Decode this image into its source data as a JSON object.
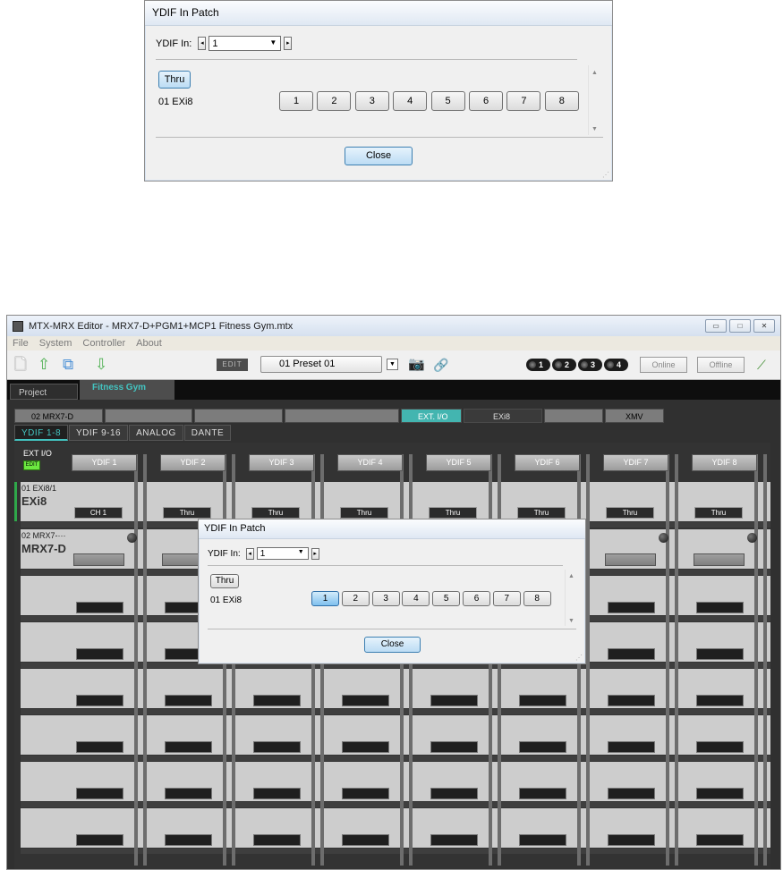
{
  "top_dialog": {
    "title": "YDIF In Patch",
    "ydif_label": "YDIF In:",
    "ydif_value": "1",
    "thru_label": "Thru",
    "device_label": "01 EXi8",
    "channels": [
      "1",
      "2",
      "3",
      "4",
      "5",
      "6",
      "7",
      "8"
    ],
    "close_label": "Close"
  },
  "editor": {
    "title": "MTX-MRX Editor - MRX7-D+PGM1+MCP1 Fitness Gym.mtx",
    "menu": [
      "File",
      "System",
      "Controller",
      "About"
    ],
    "toolbar": {
      "edit_label": "EDIT",
      "preset_value": "01 Preset 01",
      "scenes": [
        "1",
        "2",
        "3",
        "4"
      ],
      "online_label": "Online",
      "offline_label": "Offline"
    },
    "project_tabs": [
      "Project",
      "Fitness Gym"
    ],
    "device_tabs": [
      "02 MRX7-D",
      "",
      "",
      "",
      "EXT. I/O",
      "EXi8",
      "",
      "XMV"
    ],
    "sub_tabs": [
      "YDIF 1-8",
      "YDIF 9-16",
      "ANALOG",
      "DANTE"
    ],
    "grid": {
      "ext_io_label": "EXT I/O",
      "edit_small": "EDIT",
      "ydif_headers": [
        "YDIF 1",
        "YDIF 2",
        "YDIF 3",
        "YDIF 4",
        "YDIF 5",
        "YDIF 6",
        "YDIF 7",
        "YDIF 8"
      ],
      "row1_label": "01 EXi8/1",
      "row1_name": "EXi8",
      "row1_ch": "CH 1",
      "thru_label": "Thru",
      "row2_label": "02 MRX7-···",
      "row2_name": "MRX7-D"
    }
  },
  "inner_dialog": {
    "title": "YDIF In Patch",
    "ydif_label": "YDIF In:",
    "ydif_value": "1",
    "thru_label": "Thru",
    "device_label": "01 EXi8",
    "channels": [
      "1",
      "2",
      "3",
      "4",
      "5",
      "6",
      "7",
      "8"
    ],
    "selected_channel": "1",
    "close_label": "Close"
  }
}
